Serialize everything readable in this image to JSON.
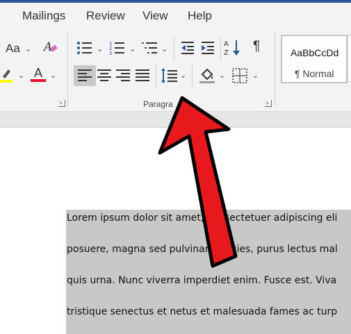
{
  "tabs": [
    {
      "label": "Mailings"
    },
    {
      "label": "Review"
    },
    {
      "label": "View"
    },
    {
      "label": "Help"
    }
  ],
  "font": {
    "change_case_label": "Aa",
    "font_color_letter": "A",
    "highlight_color": "#ffff00",
    "font_color": "#e81123"
  },
  "paragraph": {
    "group_label": "Paragra"
  },
  "styles": {
    "sample_text": "AaBbCcDd",
    "normal_label": "¶ Normal"
  },
  "document": {
    "lines": [
      "Lorem ipsum dolor sit amet, consectetuer adipiscing eli",
      "posuere, magna sed pulvinar ultricies, purus lectus mal",
      "quis urna. Nunc viverra imperdiet enim. Fusce est. Viva",
      "tristique senectus et netus et malesuada fames ac turp"
    ]
  },
  "annotation": {
    "arrow_color": "#e8191c"
  }
}
